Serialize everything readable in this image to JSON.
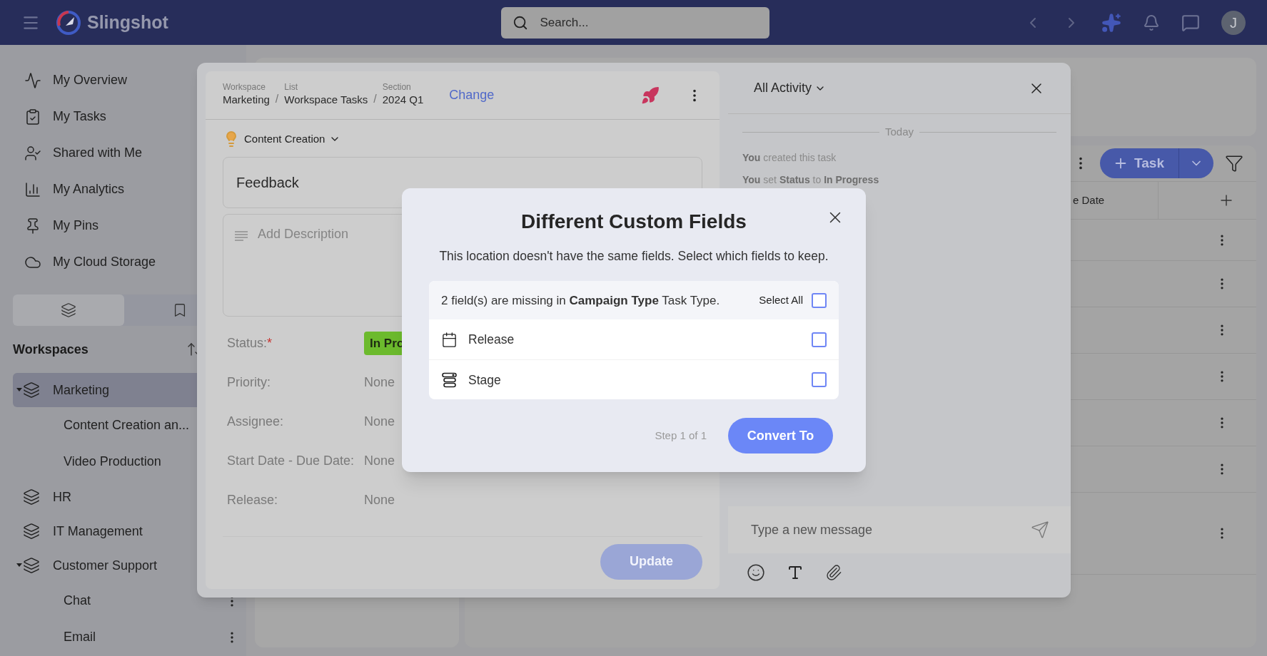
{
  "top_bar": {
    "app_name": "Slingshot",
    "search": {
      "placeholder": "Search..."
    },
    "avatar": "J"
  },
  "sidebar": {
    "nav": [
      "My Overview",
      "My Tasks",
      "Shared with Me",
      "My Analytics",
      "My Pins",
      "My Cloud Storage"
    ],
    "tabs": [
      {
        "selected": true
      },
      {
        "selected": false
      }
    ],
    "workspaces_title": "Workspaces",
    "workspaces": [
      {
        "label": "Marketing",
        "expanded": true,
        "selected": true,
        "children": [
          {
            "label": "Content Creation an...",
            "menu": false
          },
          {
            "label": "Video Production",
            "menu": false
          }
        ]
      },
      {
        "label": "HR",
        "expanded": false,
        "selected": false
      },
      {
        "label": "IT Management",
        "expanded": false,
        "selected": false
      },
      {
        "label": "Customer Support",
        "expanded": true,
        "selected": false,
        "children": [
          {
            "label": "Chat",
            "menu": true
          },
          {
            "label": "Email",
            "menu": true
          }
        ]
      }
    ]
  },
  "board": {
    "add_task_button": "Task",
    "column_header": "e Date"
  },
  "task_panel": {
    "breadcrumb": [
      {
        "caption": "Workspace",
        "value": "Marketing"
      },
      {
        "separator": "/",
        "caption": "List",
        "value": "Workspace Tasks"
      },
      {
        "separator": "/",
        "caption": "Section",
        "value": "2024 Q1"
      }
    ],
    "change_link": "Change",
    "task_type": "Content Creation",
    "title": "Feedback",
    "description": {
      "placeholder": "Add Description"
    },
    "fields": [
      {
        "label": "Status:",
        "required_mark": "*",
        "kind": "status",
        "value": "In Pro"
      },
      {
        "label": "Priority:",
        "kind": "text",
        "value": "None"
      },
      {
        "label": "Assignee:",
        "kind": "text",
        "value": "None"
      },
      {
        "label": "Start Date - Due Date:",
        "kind": "text",
        "value": "None"
      },
      {
        "label": "Release:",
        "kind": "text",
        "value": "None"
      }
    ],
    "update_button": {
      "label": "Update",
      "disabled": true
    }
  },
  "activity": {
    "filter": "All Activity",
    "date_divider": "Today",
    "entries": [
      "**You** created this task",
      "**You** set **Status** to **In Progress**"
    ],
    "message": {
      "placeholder": "Type a new message"
    }
  },
  "modal": {
    "title": "Different Custom Fields",
    "description": "This location doesn't have the same fields. Select which fields to keep.",
    "missing_note": "2 field(s) are missing in **Campaign Type** Task Type.",
    "select_all": {
      "label": "Select All",
      "checked": false
    },
    "fields": [
      {
        "label": "Release",
        "kind": "date",
        "checked": false
      },
      {
        "label": "Stage",
        "kind": "dropdown",
        "checked": false
      }
    ],
    "step": "Step 1 of 1",
    "primary_button": "Convert To"
  }
}
